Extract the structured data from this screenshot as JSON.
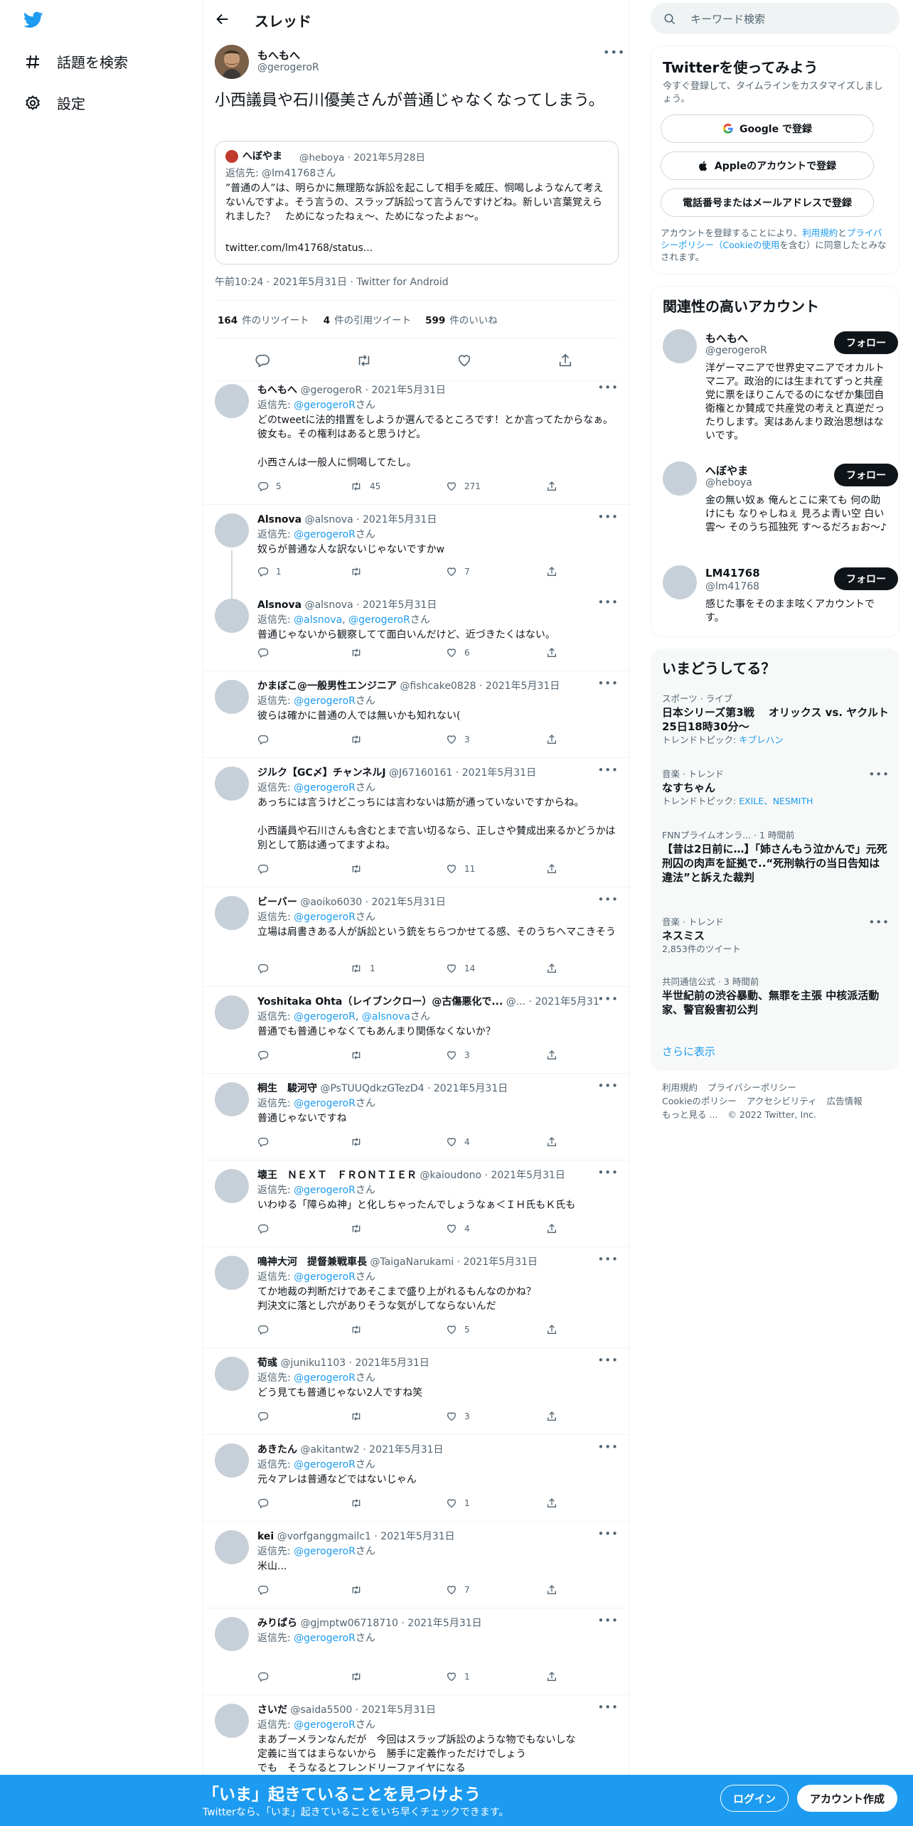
{
  "nav": {
    "explore": "話題を検索",
    "settings": "設定"
  },
  "header": {
    "title": "スレッド"
  },
  "focal": {
    "name": "もへもへ",
    "handle": "@gerogeroR",
    "text": "小西議員や石川優美さんが普通じゃなくなってしまう。",
    "quote": {
      "name": "へぼやま",
      "meta": "@heboya · 2021年5月28日",
      "reply_to": "返信先: @lm41768さん",
      "text": "”普通の人”は、明らかに無理筋な訴訟を起こして相手を威圧、恫喝しようなんて考えないんですよ。そう言うの、スラップ訴訟って言うんですけどね。新しい言葉覚えられました？　ためになったねぇ～、ためになったよぉ～。",
      "link": "twitter.com/lm41768/status..."
    },
    "meta": "午前10:24 · 2021年5月31日 · Twitter for Android",
    "stats": {
      "retweets": "164",
      "retweets_label": "件のリツイート",
      "quotes": "4",
      "quotes_label": "件の引用ツイート",
      "likes": "599",
      "likes_label": "件のいいね"
    }
  },
  "replies": [
    {
      "name": "もへもへ",
      "meta": "@gerogeroR · 2021年5月31日",
      "to": [
        "@gerogeroR"
      ],
      "text": "どのtweetに法的措置をしようか選んでるところです！とか言ってたからなぁ。彼女も。その権利はあると思うけど。\n\n小西さんは一般人に恫喝してたし。",
      "reply": "5",
      "rt": "45",
      "like": "271"
    },
    {
      "name": "Alsnova",
      "meta": "@alsnova · 2021年5月31日",
      "to": [
        "@gerogeroR"
      ],
      "text": "奴らが普通な人な訳ないじゃないですかw",
      "reply": "1",
      "rt": "",
      "like": "7"
    },
    {
      "name": "Alsnova",
      "meta": "@alsnova · 2021年5月31日",
      "to": [
        "@alsnova",
        "@gerogeroR"
      ],
      "text": "普通じゃないから観察してて面白いんだけど、近づきたくはない。",
      "reply": "",
      "rt": "",
      "like": "6"
    },
    {
      "name": "かまぼこ@一般男性エンジニア",
      "meta": "@fishcake0828 · 2021年5月31日",
      "to": [
        "@gerogeroR"
      ],
      "text": "彼らは確かに普通の人では無いかも知れない(",
      "reply": "",
      "rt": "",
      "like": "3"
    },
    {
      "name": "ジルク【GC〆】チャンネルJ",
      "meta": "@J67160161 · 2021年5月31日",
      "to": [
        "@gerogeroR"
      ],
      "text": "あっちには言うけどこっちには言わないは筋が通っていないですからね。\n\n小西議員や石川さんも含むとまで言い切るなら、正しさや賛成出来るかどうかは別として筋は通ってますよね。",
      "reply": "",
      "rt": "",
      "like": "11"
    },
    {
      "name": "ビーバー",
      "meta": "@aoiko6030 · 2021年5月31日",
      "to": [
        "@gerogeroR"
      ],
      "text": "立場は肩書きある人が訴訟という銃をちらつかせてる感、そのうちヘマこきそう",
      "reply": "",
      "rt": "1",
      "like": "14"
    },
    {
      "name": "Yoshitaka Ohta（レイブンクロー）@古傷悪化で...",
      "meta": "@... · 2021年5月31日",
      "to": [
        "@gerogeroR",
        "@alsnova"
      ],
      "text": "普通でも普通じゃなくてもあんまり関係なくないか？",
      "reply": "",
      "rt": "",
      "like": "3"
    },
    {
      "name": "桐生　駿河守",
      "meta": "@PsTUUQdkzGTezD4 · 2021年5月31日",
      "to": [
        "@gerogeroR"
      ],
      "text": "普通じゃないですね",
      "reply": "",
      "rt": "",
      "like": "4"
    },
    {
      "name": "壊王　ＮＥＸＴ　ＦＲＯＮＴＩＥＲ",
      "meta": "@kaioudono · 2021年5月31日",
      "to": [
        "@gerogeroR"
      ],
      "text": "いわゆる「障らぬ神」と化しちゃったんでしょうなぁ＜ＩＨ氏もＫ氏も",
      "reply": "",
      "rt": "",
      "like": "4"
    },
    {
      "name": "鳴神大河　提督兼戦車長",
      "meta": "@TaigaNarukami · 2021年5月31日",
      "to": [
        "@gerogeroR"
      ],
      "text": "てか地裁の判断だけであそこまで盛り上がれるもんなのかね？\n判決文に落とし穴がありそうな気がしてならないんだ",
      "reply": "",
      "rt": "",
      "like": "5"
    },
    {
      "name": "荀彧",
      "meta": "@juniku1103 · 2021年5月31日",
      "to": [
        "@gerogeroR"
      ],
      "text": "どう見ても普通じゃない2人ですね笑",
      "reply": "",
      "rt": "",
      "like": "3"
    },
    {
      "name": "あきたん",
      "meta": "@akitantw2 · 2021年5月31日",
      "to": [
        "@gerogeroR"
      ],
      "text": "元々アレは普通などではないじゃん",
      "reply": "",
      "rt": "",
      "like": "1"
    },
    {
      "name": "kei",
      "meta": "@vorfganggmailc1 · 2021年5月31日",
      "to": [
        "@gerogeroR"
      ],
      "text": "米山...",
      "reply": "",
      "rt": "",
      "like": "7"
    },
    {
      "name": "みりぱら",
      "meta": "@gjmptw06718710 · 2021年5月31日",
      "to": [
        "@gerogeroR"
      ],
      "text": "",
      "reply": "",
      "rt": "",
      "like": "1"
    },
    {
      "name": "さいだ",
      "meta": "@saida5500 · 2021年5月31日",
      "to": [
        "@gerogeroR"
      ],
      "text": "まあブーメランなんだが　今回はスラップ訴訟のような物でもないしな\n定義に当てはまらないから　勝手に定義作っただけでしょう\nでも　そうなるとフレンドリーファイヤになる",
      "reply": "",
      "rt": "",
      "like": ""
    }
  ],
  "reply_to_prefix": "返信先: ",
  "reply_to_suffix": "さん",
  "right": {
    "search_placeholder": "キーワード検索",
    "signup": {
      "title": "Twitterを使ってみよう",
      "desc": "今すぐ登録して、タイムラインをカスタマイズしましょう。",
      "google": "Google で登録",
      "apple": "Appleのアカウントで登録",
      "phone": "電話番号またはメールアドレスで登録",
      "terms_pre": "アカウントを登録することにより、",
      "terms_link1": "利用規約",
      "terms_mid": "と",
      "terms_link2": "プライバシーポリシー（Cookieの使用",
      "terms_post": "を含む）に同意したとみなされます。"
    },
    "related": {
      "title": "関連性の高いアカウント",
      "follow": "フォロー",
      "accounts": [
        {
          "name": "もへもへ",
          "handle": "@gerogeroR",
          "bio": "洋ゲーマニアで世界史マニアでオカルトマニア。政治的には生まれてずっと共産党に票をほりこんでるのになぜか集団自衛権とか賛成で共産党の考えと真逆だったりします。実はあんまり政治思想はないです。"
        },
        {
          "name": "へぼやま",
          "handle": "@heboya",
          "bio": "金の無い奴ぁ 俺んとこに来ても 何の助けにも なりゃしねぇ 見ろよ青い空 白い雲～ そのうち孤独死 す～るだろぉお～♪"
        },
        {
          "name": "LM41768",
          "handle": "@lm41768",
          "bio": "感じた事をそのまま呟くアカウントです。"
        }
      ]
    },
    "trends": {
      "title": "いまどうしてる？",
      "items": [
        {
          "cat": "スポーツ · ライブ",
          "name": "日本シリーズ第3戦　 オリックス vs. ヤクルト 25日18時30分〜",
          "sub_pre": "トレンドトピック: ",
          "sub_link": "キブレハン"
        },
        {
          "cat": "音楽 · トレンド",
          "name": "なすちゃん",
          "sub_pre": "トレンドトピック: ",
          "sub_link": "EXILE、NESMITH"
        },
        {
          "cat": "FNNプライムオンラ... · 1 時間前",
          "name": "【昔は2日前に…】「姉さんもう泣かんで」元死刑囚の肉声を証拠で..“死刑執行の当日告知は違法”と訴えた裁判",
          "sub_pre": "",
          "sub_link": ""
        },
        {
          "cat": "音楽 · トレンド",
          "name": "ネスミス",
          "sub_pre": "2,853件のツイート",
          "sub_link": ""
        },
        {
          "cat": "共同通信公式 · 3 時間前",
          "name": "半世紀前の渋谷暴動、無罪を主張 中核派活動家、警官殺害初公判",
          "sub_pre": "",
          "sub_link": ""
        }
      ],
      "show_more": "さらに表示"
    },
    "footer": [
      "利用規約",
      "プライバシーポリシー",
      "Cookieのポリシー",
      "アクセシビリティ",
      "広告情報",
      "もっと見る ...",
      "© 2022 Twitter, Inc."
    ]
  },
  "bottom": {
    "headline": "「いま」起きていることを見つけよう",
    "sub": "Twitterなら、「いま」起きていることをいち早くチェックできます。",
    "login": "ログイン",
    "signup": "アカウント作成"
  },
  "colors": {
    "accent": "#1d9bf0",
    "text": "#0f1419",
    "muted": "#536471"
  }
}
